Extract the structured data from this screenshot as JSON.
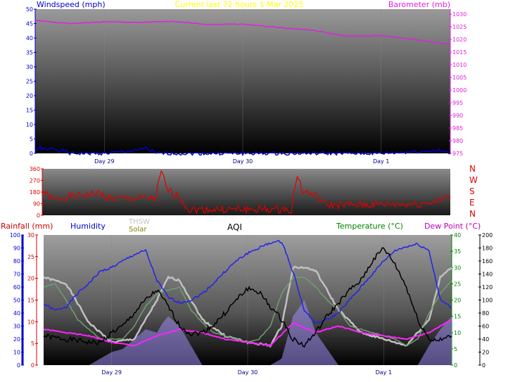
{
  "header": {
    "title": "Current last 72 hours 1 Mar 2025",
    "windspeed_label": "Windspeed (mph)",
    "barometer_label": "Barometer (mb)"
  },
  "colors": {
    "title": "#ffff00",
    "windspeed": "#0000cc",
    "barometer": "#e020e0",
    "wind_dir": "#e00000",
    "rainfall": "#cc0000",
    "humidity": "#0000cc",
    "thsw": "#c0c0c0",
    "solar": "#808000",
    "aqi": "#000000",
    "temperature": "#008000",
    "dew_point": "#c000c0"
  },
  "day_labels": [
    "Day 29",
    "Day 30",
    "Day 1"
  ],
  "panel_bottom": {
    "rainfall_label": "Rainfall (mm)",
    "humidity_label": "Humidity",
    "thsw_label": "THSW",
    "solar_label": "Solar",
    "aqi_label": "AQI",
    "temperature_label": "Temperature (°C)",
    "dew_point_label": "Dew Point (°C)"
  },
  "compass": [
    "N",
    "W",
    "S",
    "E",
    "N"
  ],
  "chart_data": [
    {
      "type": "line",
      "title": "Current last 72 hours 1 Mar 2025",
      "x_unit": "hours",
      "x_categories": [
        "Day 29",
        "Day 30",
        "Day 1"
      ],
      "axes": {
        "left": {
          "label": "Windspeed (mph)",
          "ticks": [
            0,
            5,
            10,
            15,
            20,
            25,
            30,
            35,
            40,
            45,
            50
          ],
          "ylim": [
            0,
            50
          ]
        },
        "right": {
          "label": "Barometer (mb)",
          "ticks": [
            975,
            980,
            985,
            990,
            995,
            1000,
            1005,
            1010,
            1015,
            1020,
            1025,
            1030
          ],
          "ylim": [
            975,
            1032
          ]
        }
      },
      "series": [
        {
          "name": "Barometer (mb)",
          "axis": "right",
          "x": [
            0,
            6,
            12,
            18,
            24,
            30,
            36,
            42,
            48,
            54,
            60,
            66,
            72
          ],
          "values": [
            1027.5,
            1026.3,
            1027.0,
            1026.7,
            1027.2,
            1025.9,
            1026.1,
            1024.8,
            1023.7,
            1021.3,
            1021.5,
            1020.0,
            1018.0
          ]
        },
        {
          "name": "Windspeed (mph)",
          "axis": "left",
          "x": [
            0,
            1,
            2,
            3,
            4,
            5,
            6,
            12,
            18,
            19,
            20,
            21,
            24,
            36,
            42,
            48,
            60,
            70,
            72
          ],
          "values": [
            1,
            2,
            1,
            2,
            1,
            1,
            0,
            0,
            1,
            2,
            1,
            0,
            0,
            0,
            0,
            0,
            0,
            1,
            0
          ]
        }
      ]
    },
    {
      "type": "line",
      "title": "",
      "axes": {
        "left": {
          "label": "",
          "ticks": [
            0,
            90,
            180,
            270,
            360
          ],
          "ylim": [
            0,
            360
          ]
        }
      },
      "right_labels": [
        "N",
        "W",
        "S",
        "E",
        "N"
      ],
      "series": [
        {
          "name": "Wind direction",
          "x": [
            0,
            1,
            2,
            4,
            6,
            8,
            10,
            12,
            16,
            20,
            21,
            22,
            24,
            26,
            28,
            36,
            44,
            45,
            46,
            48,
            50,
            56,
            60,
            66,
            70,
            72
          ],
          "values": [
            190,
            150,
            120,
            140,
            150,
            160,
            170,
            130,
            130,
            130,
            340,
            200,
            150,
            40,
            45,
            45,
            45,
            320,
            180,
            160,
            80,
            80,
            85,
            85,
            110,
            150
          ]
        }
      ]
    },
    {
      "type": "line",
      "title": "",
      "axes": {
        "rainfall": {
          "label": "Rainfall (mm)",
          "ticks": [
            0,
            5,
            10,
            15,
            20,
            25,
            30
          ],
          "ylim": [
            0,
            30
          ]
        },
        "humidity": {
          "label": "Humidity",
          "ticks": [
            0,
            10,
            20,
            30,
            40,
            50,
            60,
            70,
            80,
            90,
            100
          ],
          "ylim": [
            0,
            100
          ]
        },
        "temperature": {
          "label": "Temperature (°C)",
          "ticks": [
            0,
            5,
            10,
            15,
            20,
            25,
            30,
            35,
            40
          ],
          "ylim": [
            0,
            40
          ]
        },
        "aqi": {
          "label": "",
          "ticks": [
            0,
            20,
            40,
            60,
            80,
            100,
            120,
            140,
            160,
            180,
            200
          ],
          "ylim": [
            0,
            200
          ]
        }
      },
      "series": [
        {
          "name": "Humidity",
          "axis": "humidity",
          "x": [
            0,
            2,
            4,
            6,
            8,
            10,
            12,
            14,
            16,
            18,
            20,
            22,
            24,
            26,
            28,
            30,
            32,
            34,
            36,
            38,
            40,
            42,
            44,
            46,
            48,
            50,
            52,
            54,
            56,
            58,
            60,
            62,
            64,
            66,
            68,
            70,
            72
          ],
          "values": [
            47,
            42,
            45,
            55,
            63,
            72,
            75,
            80,
            85,
            88,
            65,
            52,
            48,
            50,
            55,
            63,
            72,
            80,
            86,
            90,
            94,
            95,
            72,
            42,
            32,
            35,
            40,
            50,
            60,
            70,
            80,
            88,
            91,
            93,
            88,
            50,
            44
          ]
        },
        {
          "name": "Temperature (°C)",
          "axis": "temperature",
          "x": [
            0,
            2,
            4,
            6,
            8,
            10,
            12,
            14,
            16,
            18,
            20,
            22,
            24,
            26,
            28,
            30,
            32,
            34,
            36,
            38,
            40,
            42,
            44,
            46,
            48,
            50,
            52,
            54,
            56,
            58,
            60,
            62,
            64,
            66,
            68,
            70,
            72
          ],
          "values": [
            24,
            25,
            20,
            14,
            11,
            8,
            8,
            8,
            12,
            18,
            22,
            23,
            24,
            17,
            13,
            10,
            9,
            8,
            7,
            8,
            12,
            22,
            27,
            27,
            24,
            20,
            17,
            12,
            11,
            10,
            9,
            8,
            6,
            8,
            16,
            22,
            26
          ]
        },
        {
          "name": "THSW",
          "axis": "temperature",
          "x": [
            0,
            4,
            8,
            12,
            16,
            20,
            22,
            24,
            28,
            32,
            36,
            40,
            42,
            44,
            46,
            48,
            52,
            56,
            60,
            64,
            68,
            70,
            72
          ],
          "values": [
            27,
            25,
            13,
            7,
            8,
            20,
            27,
            26,
            14,
            9,
            7,
            6,
            12,
            30,
            30,
            29,
            17,
            10,
            8,
            6,
            14,
            27,
            30
          ]
        },
        {
          "name": "Dew Point (°C)",
          "axis": "temperature",
          "x": [
            0,
            4,
            8,
            12,
            16,
            20,
            24,
            28,
            32,
            36,
            40,
            44,
            48,
            52,
            56,
            60,
            64,
            68,
            72
          ],
          "values": [
            11,
            10,
            9,
            7,
            6,
            9,
            11,
            10,
            8,
            7,
            6,
            13,
            10,
            12,
            10,
            9,
            8,
            10,
            14
          ]
        },
        {
          "name": "AQI",
          "axis": "aqi",
          "x": [
            0,
            2,
            4,
            6,
            8,
            10,
            12,
            14,
            16,
            18,
            20,
            22,
            24,
            26,
            28,
            30,
            32,
            34,
            36,
            38,
            40,
            42,
            44,
            46,
            48,
            50,
            52,
            54,
            56,
            58,
            60,
            62,
            64,
            66,
            68,
            70,
            72
          ],
          "values": [
            45,
            42,
            40,
            38,
            35,
            34,
            50,
            60,
            80,
            100,
            115,
            90,
            60,
            48,
            50,
            62,
            80,
            100,
            118,
            112,
            90,
            70,
            40,
            30,
            50,
            75,
            95,
            115,
            130,
            160,
            180,
            155,
            120,
            70,
            40,
            38,
            45
          ]
        },
        {
          "name": "Solar",
          "axis": "temperature",
          "x": [
            0,
            6,
            8,
            10,
            12,
            14,
            16,
            18,
            20,
            21,
            22,
            24,
            28,
            32,
            36,
            40,
            42,
            44,
            46,
            48,
            52,
            56,
            60,
            64,
            66,
            68,
            70,
            72
          ],
          "values": [
            0,
            0,
            0,
            2,
            4,
            5,
            8,
            11,
            10,
            13,
            15,
            12,
            0,
            0,
            0,
            0,
            2,
            15,
            20,
            10,
            0,
            0,
            0,
            0,
            0,
            6,
            11,
            15
          ]
        },
        {
          "name": "Rainfall (mm)",
          "axis": "rainfall",
          "x": [
            0,
            8,
            12,
            16,
            20,
            22,
            24,
            28,
            32,
            36,
            40,
            44,
            48,
            52,
            60,
            66,
            70,
            72
          ],
          "values": [
            0,
            0,
            0,
            0,
            0,
            0,
            0,
            0,
            0,
            0,
            0,
            0,
            0,
            0,
            0,
            0,
            0,
            0
          ]
        }
      ]
    }
  ]
}
